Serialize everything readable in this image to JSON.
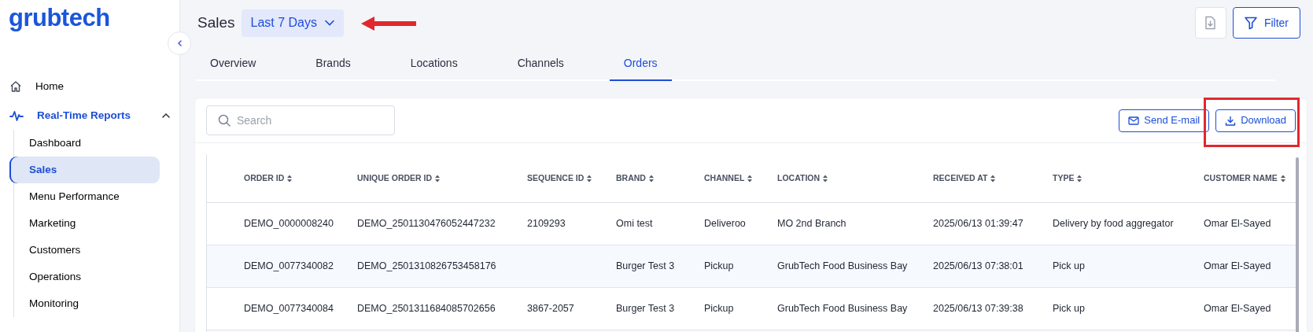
{
  "logo": "grubtech",
  "sidebar": {
    "items": [
      {
        "label": "Home",
        "kind": "link",
        "selected": false
      },
      {
        "label": "Real-Time Reports",
        "kind": "group",
        "selected": true,
        "expanded": true,
        "children": [
          {
            "label": "Dashboard",
            "selected": false
          },
          {
            "label": "Sales",
            "selected": true
          },
          {
            "label": "Menu Performance",
            "selected": false
          },
          {
            "label": "Marketing",
            "selected": false
          },
          {
            "label": "Customers",
            "selected": false
          },
          {
            "label": "Operations",
            "selected": false
          },
          {
            "label": "Monitoring",
            "selected": false
          }
        ]
      }
    ]
  },
  "header": {
    "title": "Sales",
    "date_range": "Last 7 Days",
    "filter_button": "Filter"
  },
  "tabs": [
    {
      "label": "Overview",
      "selected": false
    },
    {
      "label": "Brands",
      "selected": false
    },
    {
      "label": "Locations",
      "selected": false
    },
    {
      "label": "Channels",
      "selected": false
    },
    {
      "label": "Orders",
      "selected": true
    }
  ],
  "search": {
    "placeholder": "Search"
  },
  "actions": [
    {
      "label": "Send E-mail",
      "kind": "mail"
    },
    {
      "label": "Download",
      "kind": "download"
    }
  ],
  "table": {
    "columns": [
      "ORDER ID",
      "UNIQUE ORDER ID",
      "SEQUENCE ID",
      "BRAND",
      "CHANNEL",
      "LOCATION",
      "RECEIVED AT",
      "TYPE",
      "CUSTOMER NAME"
    ],
    "rows": [
      [
        "DEMO_0000008240",
        "DEMO_2501130476052447232",
        "2109293",
        "Omi test",
        "Deliveroo",
        "MO 2nd Branch",
        "2025/06/13 01:39:47",
        "Delivery by food aggregator",
        "Omar El-Sayed"
      ],
      [
        "DEMO_0077340082",
        "DEMO_2501310826753458176",
        "",
        "Burger Test 3",
        "Pickup",
        "GrubTech Food Business Bay",
        "2025/06/13 07:38:01",
        "Pick up",
        "Omar El-Sayed"
      ],
      [
        "DEMO_0077340084",
        "DEMO_2501311684085702656",
        "3867-2057",
        "Burger Test 3",
        "Pickup",
        "GrubTech Food Business Bay",
        "2025/06/13 07:39:38",
        "Pick up",
        "Omar El-Sayed"
      ]
    ]
  }
}
